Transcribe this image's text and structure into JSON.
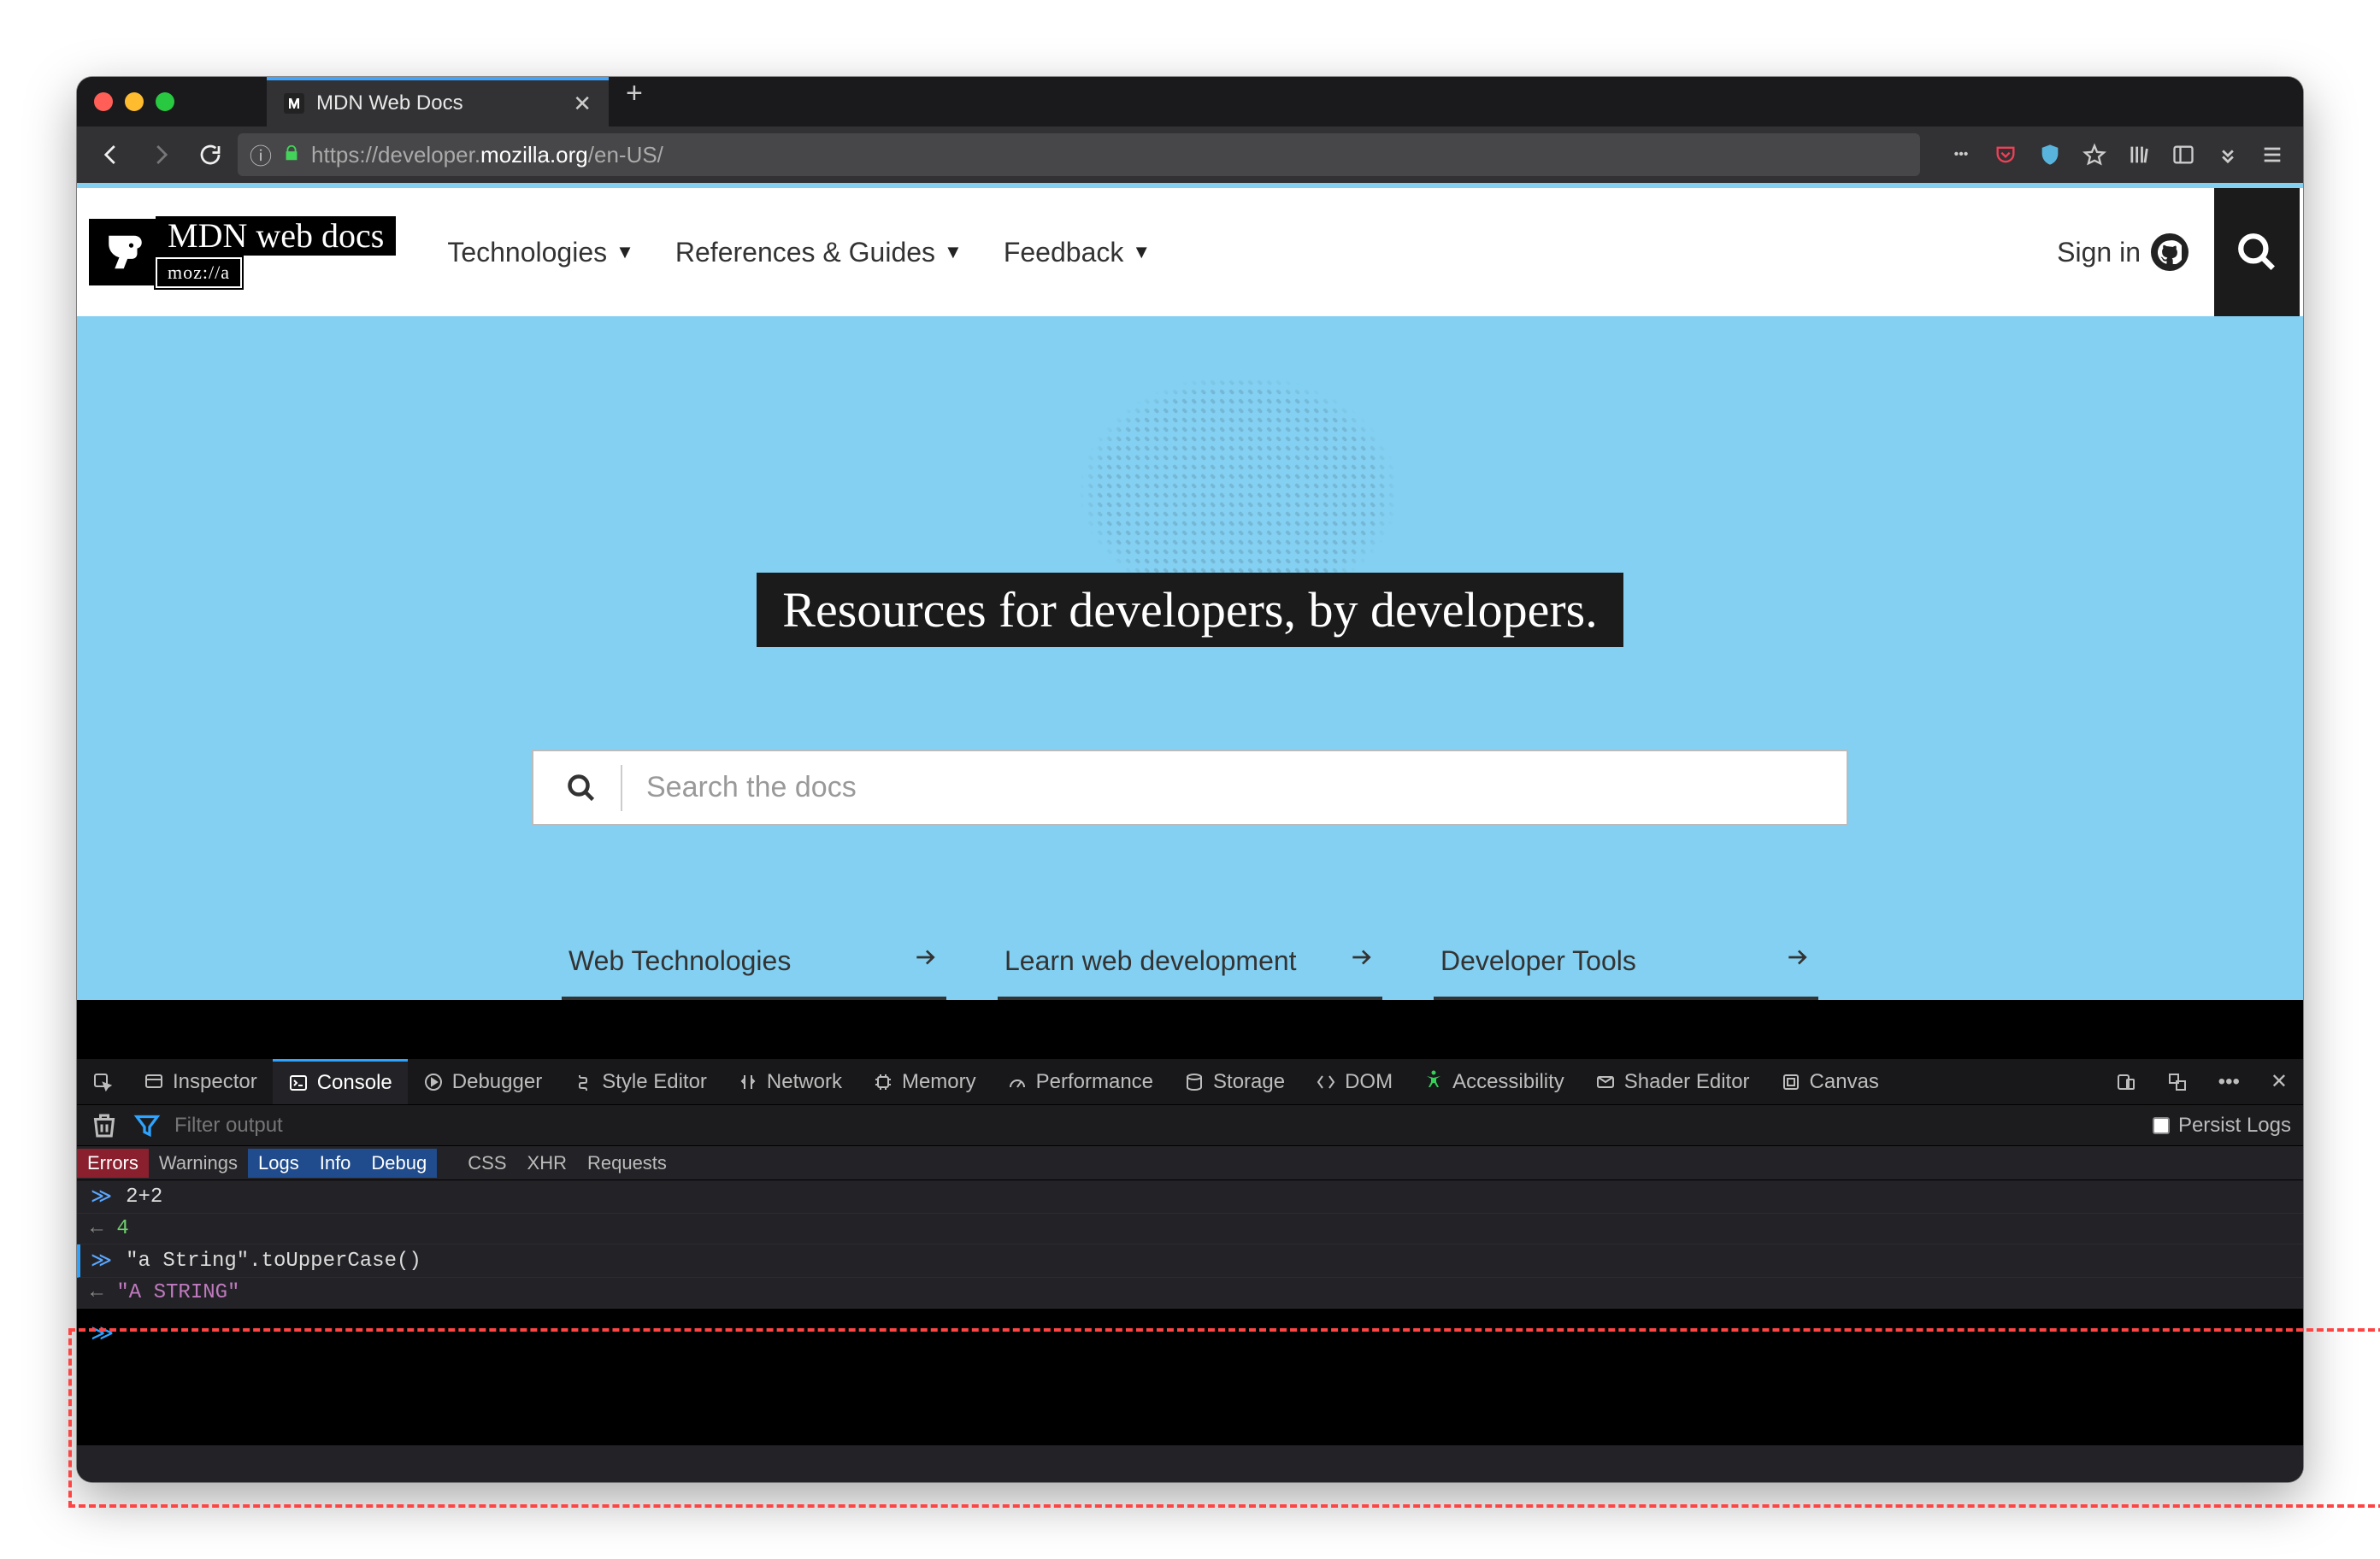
{
  "browser": {
    "tab_title": "MDN Web Docs",
    "url_host": "mozilla.org",
    "url_prefix": "https://developer.",
    "url_suffix": "/en-US/"
  },
  "site": {
    "logo_title": "MDN web docs",
    "logo_sub": "moz://a",
    "menus": [
      "Technologies",
      "References & Guides",
      "Feedback"
    ],
    "signin": "Sign in"
  },
  "hero": {
    "title": "Resources for developers, by developers.",
    "search_placeholder": "Search the docs",
    "shortcuts": [
      "Web Technologies",
      "Learn web development",
      "Developer Tools"
    ]
  },
  "devtools": {
    "tabs": [
      "Inspector",
      "Console",
      "Debugger",
      "Style Editor",
      "Network",
      "Memory",
      "Performance",
      "Storage",
      "DOM",
      "Accessibility",
      "Shader Editor",
      "Canvas"
    ],
    "active_tab": "Console",
    "filter_placeholder": "Filter output",
    "persist_label": "Persist Logs",
    "categories": {
      "errors": "Errors",
      "warnings": "Warnings",
      "logs": "Logs",
      "info": "Info",
      "debug": "Debug",
      "css": "CSS",
      "xhr": "XHR",
      "requests": "Requests"
    },
    "console_rows": [
      {
        "type": "in",
        "text": "2+2"
      },
      {
        "type": "out",
        "class": "val-num",
        "text": "4"
      },
      {
        "type": "in",
        "text": "\"a String\".toUpperCase()"
      },
      {
        "type": "out",
        "class": "val-str",
        "text": "\"A STRING\""
      }
    ]
  }
}
